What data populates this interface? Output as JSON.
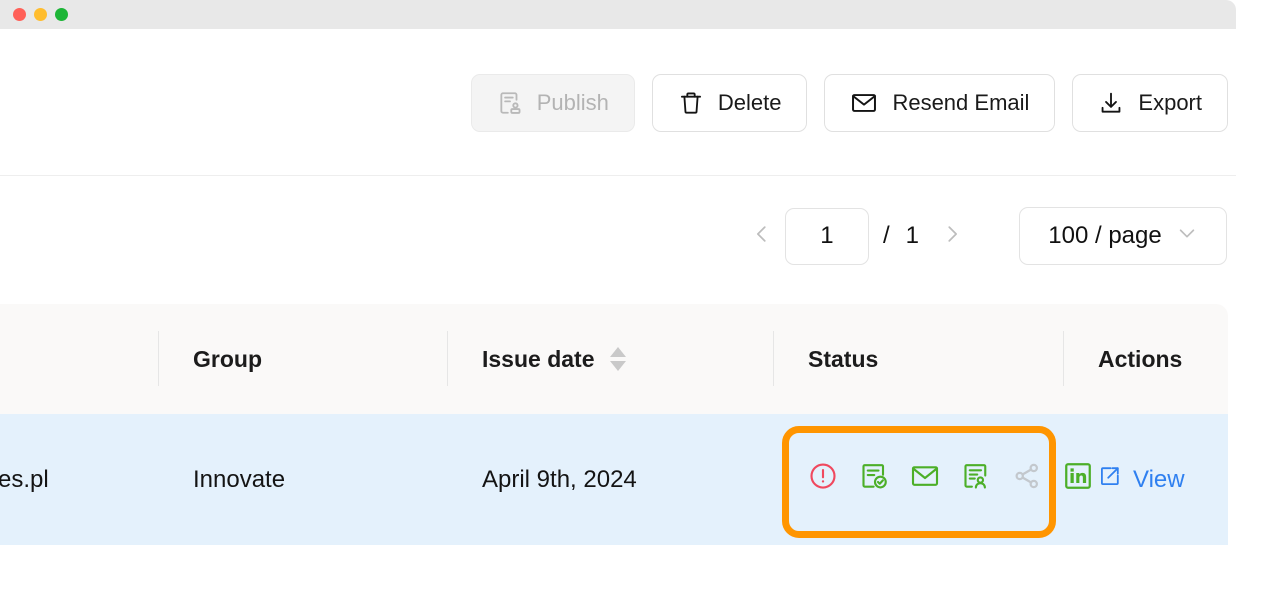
{
  "window": {
    "traffic_lights": [
      "close-red",
      "minimize-yellow",
      "maximize-green"
    ],
    "colors": {
      "chrome_bg": "#e8e8e8",
      "red": "#ff6058",
      "yellow": "#ffbd2e",
      "green": "#1db537"
    }
  },
  "toolbar": {
    "buttons": [
      {
        "label": "Publish",
        "icon": "document-user-icon",
        "disabled": true
      },
      {
        "label": "Delete",
        "icon": "trash-icon",
        "disabled": false
      },
      {
        "label": "Resend Email",
        "icon": "envelope-icon",
        "disabled": false
      },
      {
        "label": "Export",
        "icon": "download-icon",
        "disabled": false
      }
    ]
  },
  "pagination": {
    "prev_icon": "chevron-left-icon",
    "next_icon": "chevron-right-icon",
    "current_page": "1",
    "separator": "/",
    "total_pages": "1",
    "page_size": "100 / page",
    "page_size_icon": "chevron-down-icon"
  },
  "table": {
    "columns": [
      {
        "key": "recipient",
        "label": "",
        "sortable": false
      },
      {
        "key": "group",
        "label": "Group",
        "sortable": false
      },
      {
        "key": "issuedate",
        "label": "Issue date",
        "sortable": true,
        "sort_icon": "sort-updown-icon"
      },
      {
        "key": "status",
        "label": "Status",
        "sortable": false
      },
      {
        "key": "actions",
        "label": "Actions",
        "sortable": false
      }
    ],
    "rows": [
      {
        "recipient": "es.pl",
        "group": "Innovate",
        "issue_date": "April 9th, 2024",
        "status_icons": [
          {
            "name": "alert-circle-icon",
            "color": "#f0485e"
          },
          {
            "name": "document-check-icon",
            "color": "#4caf28"
          },
          {
            "name": "envelope-icon",
            "color": "#4caf28"
          },
          {
            "name": "document-recipient-icon",
            "color": "#4caf28"
          },
          {
            "name": "share-icon",
            "color": "#c3c8cd"
          },
          {
            "name": "linkedin-icon",
            "color": "#4caf28"
          }
        ],
        "actions": {
          "view_label": "View",
          "view_icon": "external-link-icon",
          "view_color": "#2f80f0"
        }
      }
    ]
  },
  "highlight": {
    "label": "status-icons-highlight",
    "color": "#ff9500"
  }
}
